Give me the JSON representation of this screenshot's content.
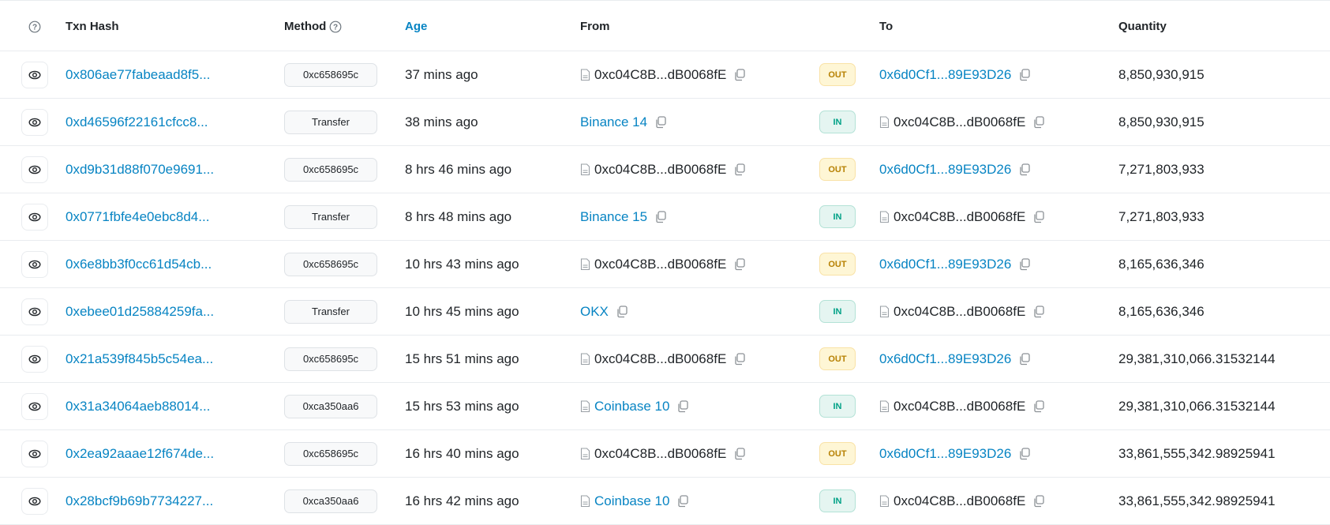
{
  "header": {
    "help_label": "?",
    "txn_hash": "Txn Hash",
    "method": "Method",
    "age": "Age",
    "from": "From",
    "to": "To",
    "quantity": "Quantity"
  },
  "colors": {
    "link": "#0784c3",
    "out_badge_text": "#b78103",
    "in_badge_text": "#00a186"
  },
  "rows": [
    {
      "hash": "0x806ae77fabeaad8f5...",
      "method": "0xc658695c",
      "age": "37 mins ago",
      "from": "0xc04C8B...dB0068fE",
      "from_is_contract": true,
      "from_is_link": false,
      "direction": "OUT",
      "to": "0x6d0Cf1...89E93D26",
      "to_is_contract": false,
      "to_is_link": true,
      "quantity": "8,850,930,915"
    },
    {
      "hash": "0xd46596f22161cfcc8...",
      "method": "Transfer",
      "age": "38 mins ago",
      "from": "Binance 14",
      "from_is_contract": false,
      "from_is_link": true,
      "direction": "IN",
      "to": "0xc04C8B...dB0068fE",
      "to_is_contract": true,
      "to_is_link": false,
      "quantity": "8,850,930,915"
    },
    {
      "hash": "0xd9b31d88f070e9691...",
      "method": "0xc658695c",
      "age": "8 hrs 46 mins ago",
      "from": "0xc04C8B...dB0068fE",
      "from_is_contract": true,
      "from_is_link": false,
      "direction": "OUT",
      "to": "0x6d0Cf1...89E93D26",
      "to_is_contract": false,
      "to_is_link": true,
      "quantity": "7,271,803,933"
    },
    {
      "hash": "0x0771fbfe4e0ebc8d4...",
      "method": "Transfer",
      "age": "8 hrs 48 mins ago",
      "from": "Binance 15",
      "from_is_contract": false,
      "from_is_link": true,
      "direction": "IN",
      "to": "0xc04C8B...dB0068fE",
      "to_is_contract": true,
      "to_is_link": false,
      "quantity": "7,271,803,933"
    },
    {
      "hash": "0x6e8bb3f0cc61d54cb...",
      "method": "0xc658695c",
      "age": "10 hrs 43 mins ago",
      "from": "0xc04C8B...dB0068fE",
      "from_is_contract": true,
      "from_is_link": false,
      "direction": "OUT",
      "to": "0x6d0Cf1...89E93D26",
      "to_is_contract": false,
      "to_is_link": true,
      "quantity": "8,165,636,346"
    },
    {
      "hash": "0xebee01d25884259fa...",
      "method": "Transfer",
      "age": "10 hrs 45 mins ago",
      "from": "OKX",
      "from_is_contract": false,
      "from_is_link": true,
      "direction": "IN",
      "to": "0xc04C8B...dB0068fE",
      "to_is_contract": true,
      "to_is_link": false,
      "quantity": "8,165,636,346"
    },
    {
      "hash": "0x21a539f845b5c54ea...",
      "method": "0xc658695c",
      "age": "15 hrs 51 mins ago",
      "from": "0xc04C8B...dB0068fE",
      "from_is_contract": true,
      "from_is_link": false,
      "direction": "OUT",
      "to": "0x6d0Cf1...89E93D26",
      "to_is_contract": false,
      "to_is_link": true,
      "quantity": "29,381,310,066.31532144"
    },
    {
      "hash": "0x31a34064aeb88014...",
      "method": "0xca350aa6",
      "age": "15 hrs 53 mins ago",
      "from": "Coinbase 10",
      "from_is_contract": true,
      "from_is_link": true,
      "direction": "IN",
      "to": "0xc04C8B...dB0068fE",
      "to_is_contract": true,
      "to_is_link": false,
      "quantity": "29,381,310,066.31532144"
    },
    {
      "hash": "0x2ea92aaae12f674de...",
      "method": "0xc658695c",
      "age": "16 hrs 40 mins ago",
      "from": "0xc04C8B...dB0068fE",
      "from_is_contract": true,
      "from_is_link": false,
      "direction": "OUT",
      "to": "0x6d0Cf1...89E93D26",
      "to_is_contract": false,
      "to_is_link": true,
      "quantity": "33,861,555,342.98925941"
    },
    {
      "hash": "0x28bcf9b69b7734227...",
      "method": "0xca350aa6",
      "age": "16 hrs 42 mins ago",
      "from": "Coinbase 10",
      "from_is_contract": true,
      "from_is_link": true,
      "direction": "IN",
      "to": "0xc04C8B...dB0068fE",
      "to_is_contract": true,
      "to_is_link": false,
      "quantity": "33,861,555,342.98925941"
    }
  ]
}
